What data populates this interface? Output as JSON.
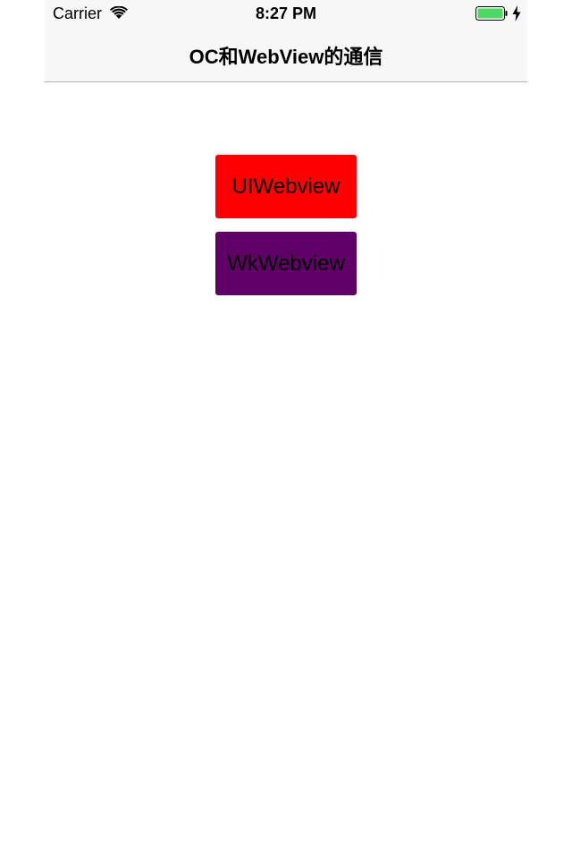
{
  "status_bar": {
    "carrier": "Carrier",
    "time": "8:27 PM",
    "wifi_icon": "wifi-icon",
    "battery_icon": "battery-icon",
    "charging_icon": "charging-bolt-icon",
    "battery_level": 1.0,
    "battery_color": "#4cd964"
  },
  "nav": {
    "title": "OC和WebView的通信",
    "background": "#f7f7f7"
  },
  "buttons": [
    {
      "label": "UIWebview",
      "color": "#fe0000"
    },
    {
      "label": "WkWebview",
      "color": "#600066"
    }
  ]
}
